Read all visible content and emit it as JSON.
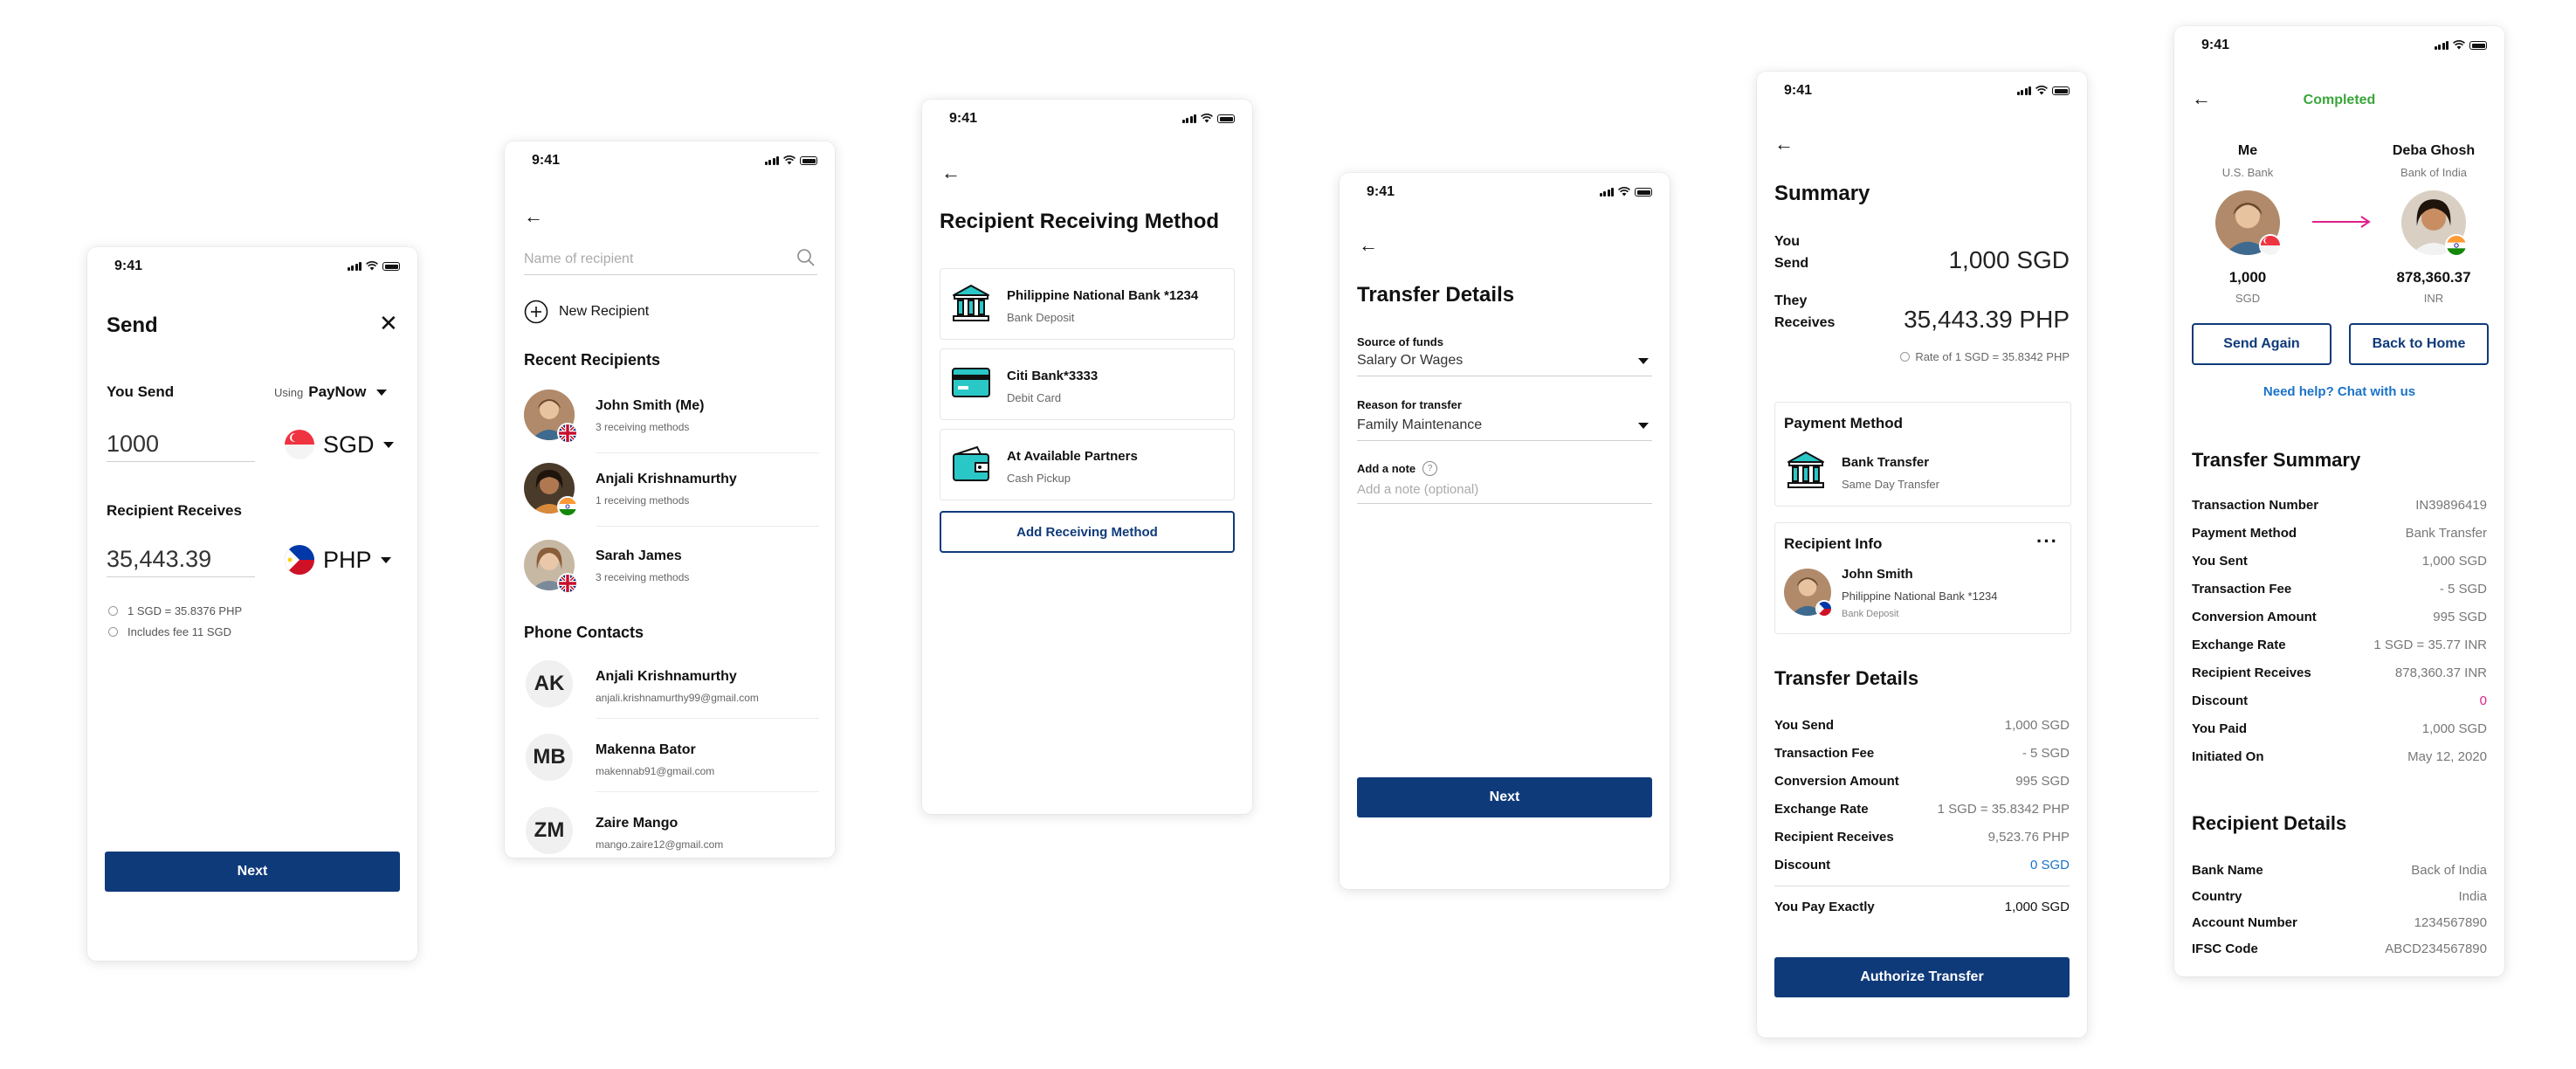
{
  "status_time": "9:41",
  "screen_send": {
    "title": "Send",
    "you_send_label": "You Send",
    "using_label": "Using",
    "using_value": "PayNow",
    "send_amount": "1000",
    "send_currency": "SGD",
    "recipient_receives_label": "Recipient Receives",
    "receive_amount": "35,443.39",
    "receive_currency": "PHP",
    "rate_note": "1 SGD = 35.8376 PHP",
    "fee_note": "Includes fee 11 SGD",
    "next_label": "Next"
  },
  "screen_recipient": {
    "search_placeholder": "Name of recipient",
    "new_recipient_label": "New Recipient",
    "recent_heading": "Recent Recipients",
    "recent": [
      {
        "name": "John Smith (Me)",
        "sub": "3 receiving methods"
      },
      {
        "name": "Anjali Krishnamurthy",
        "sub": "1 receiving methods"
      },
      {
        "name": "Sarah James",
        "sub": "3 receiving methods"
      }
    ],
    "contacts_heading": "Phone Contacts",
    "contacts": [
      {
        "initials": "AK",
        "name": "Anjali Krishnamurthy",
        "email": "anjali.krishnamurthy99@gmail.com"
      },
      {
        "initials": "MB",
        "name": "Makenna Bator",
        "email": "makennab91@gmail.com"
      },
      {
        "initials": "ZM",
        "name": "Zaire Mango",
        "email": "mango.zaire12@gmail.com"
      }
    ]
  },
  "screen_method": {
    "title": "Recipient Receiving Method",
    "methods": [
      {
        "name": "Philippine National Bank *1234",
        "sub": "Bank Deposit",
        "icon": "bank-icon"
      },
      {
        "name": "Citi Bank*3333",
        "sub": "Debit Card",
        "icon": "card-icon"
      },
      {
        "name": "At Available Partners",
        "sub": "Cash Pickup",
        "icon": "wallet-icon"
      }
    ],
    "add_label": "Add Receiving Method"
  },
  "screen_details": {
    "title": "Transfer Details",
    "source_label": "Source of funds",
    "source_value": "Salary Or Wages",
    "reason_label": "Reason for transfer",
    "reason_value": "Family Maintenance",
    "note_label": "Add a note",
    "note_placeholder": "Add a note (optional)",
    "next_label": "Next"
  },
  "screen_summary": {
    "title": "Summary",
    "you_send_l1": "You",
    "you_send_l2": "Send",
    "you_send_value": "1,000 SGD",
    "they_l1": "They",
    "they_l2": "Receives",
    "they_value": "35,443.39 PHP",
    "rate_note": "Rate of 1 SGD = 35.8342 PHP",
    "payment_heading": "Payment Method",
    "payment_name": "Bank Transfer",
    "payment_sub": "Same Day Transfer",
    "recipient_heading": "Recipient Info",
    "recipient_name": "John Smith",
    "recipient_bank": "Philippine National Bank *1234",
    "recipient_type": "Bank Deposit",
    "details_heading": "Transfer Details",
    "rows": [
      {
        "label": "You Send",
        "value": "1,000 SGD"
      },
      {
        "label": "Transaction Fee",
        "value": "- 5 SGD"
      },
      {
        "label": "Conversion Amount",
        "value": "995 SGD"
      },
      {
        "label": "Exchange Rate",
        "value": "1 SGD = 35.8342 PHP"
      },
      {
        "label": "Recipient Receives",
        "value": "9,523.76 PHP"
      },
      {
        "label": "Discount",
        "value": "0 SGD"
      }
    ],
    "total_label": "You Pay Exactly",
    "total_value": "1,000 SGD",
    "authorize_label": "Authorize Transfer",
    "discount_color": "#1a73c8"
  },
  "screen_completed": {
    "status": "Completed",
    "status_color": "#3aa53a",
    "sender_name": "Me",
    "sender_bank": "U.S. Bank",
    "sender_amount": "1,000",
    "sender_currency": "SGD",
    "receiver_name": "Deba Ghosh",
    "receiver_bank": "Bank of India",
    "receiver_amount": "878,360.37",
    "receiver_currency": "INR",
    "send_again_label": "Send Again",
    "home_label": "Back to Home",
    "help_label": "Need help? Chat with us",
    "summary_heading": "Transfer Summary",
    "summary_rows": [
      {
        "label": "Transaction Number",
        "value": "IN39896419"
      },
      {
        "label": "Payment Method",
        "value": "Bank Transfer"
      },
      {
        "label": "You Sent",
        "value": "1,000 SGD"
      },
      {
        "label": "Transaction Fee",
        "value": "- 5 SGD"
      },
      {
        "label": "Conversion Amount",
        "value": "995 SGD"
      },
      {
        "label": "Exchange Rate",
        "value": "1 SGD = 35.77 INR"
      },
      {
        "label": "Recipient Receives",
        "value": "878,360.37 INR"
      },
      {
        "label": "Discount",
        "value": "0"
      },
      {
        "label": "You Paid",
        "value": "1,000 SGD"
      },
      {
        "label": "Initiated On",
        "value": "May 12, 2020"
      }
    ],
    "recipient_heading": "Recipient Details",
    "recipient_rows": [
      {
        "label": "Bank Name",
        "value": "Back of India"
      },
      {
        "label": "Country",
        "value": "India"
      },
      {
        "label": "Account Number",
        "value": "1234567890"
      },
      {
        "label": "IFSC Code",
        "value": "ABCD234567890"
      }
    ],
    "arrow_color": "#e0218a",
    "discount_color": "#e0218a"
  }
}
